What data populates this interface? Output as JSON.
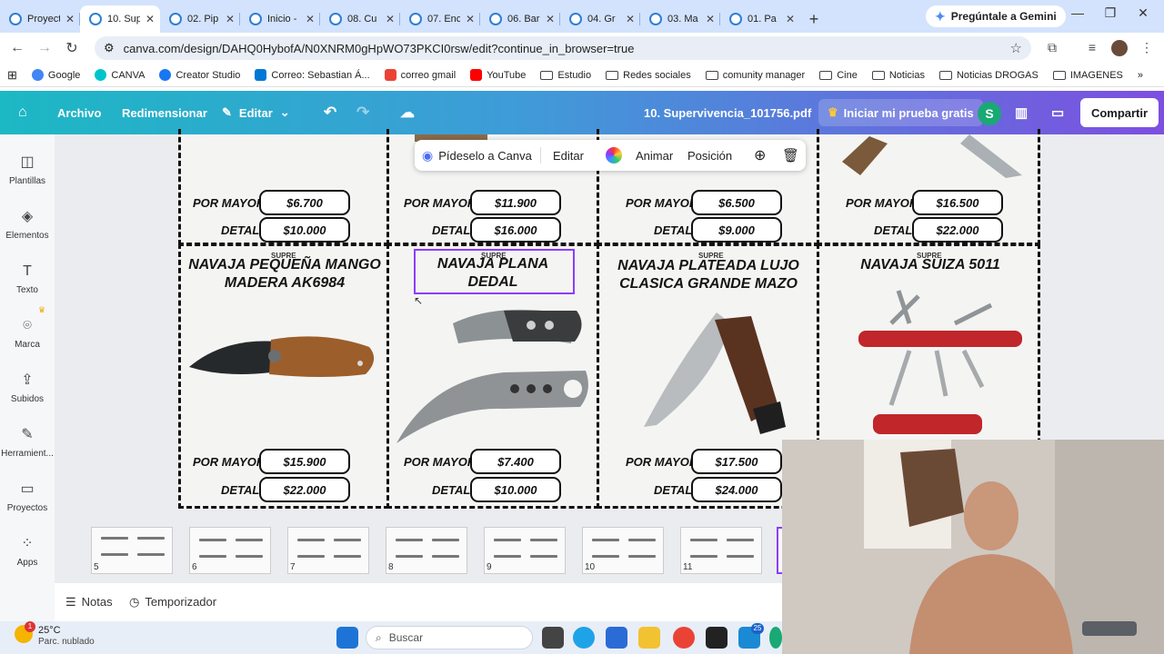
{
  "browser": {
    "tabs": [
      {
        "label": "Proyect",
        "active": false
      },
      {
        "label": "10. Sup",
        "active": true
      },
      {
        "label": "02. Pip",
        "active": false
      },
      {
        "label": "Inicio -",
        "active": false
      },
      {
        "label": "08. Cu",
        "active": false
      },
      {
        "label": "07. Enc",
        "active": false
      },
      {
        "label": "06. Bar",
        "active": false
      },
      {
        "label": "04. Gr",
        "active": false
      },
      {
        "label": "03. Ma",
        "active": false
      },
      {
        "label": "01. Pa",
        "active": false
      }
    ],
    "new_tab": "+",
    "gemini_label": "Pregúntale a Gemini",
    "url": "canva.com/design/DAHQ0HybofA/N0XNRM0gHpWO73PKCI0rsw/edit?continue_in_browser=true",
    "bookmarks": [
      {
        "label": "Google",
        "type": "site",
        "color": "#4285f4"
      },
      {
        "label": "CANVA",
        "type": "site",
        "color": "#00c4cc"
      },
      {
        "label": "Creator Studio",
        "type": "site",
        "color": "#1877f2"
      },
      {
        "label": "Correo: Sebastian Á...",
        "type": "site",
        "color": "#0078d4"
      },
      {
        "label": "correo gmail",
        "type": "site",
        "color": "#ea4335"
      },
      {
        "label": "YouTube",
        "type": "site",
        "color": "#ff0000"
      },
      {
        "label": "Estudio",
        "type": "folder"
      },
      {
        "label": "Redes sociales",
        "type": "folder"
      },
      {
        "label": "comunity manager",
        "type": "folder"
      },
      {
        "label": "Cine",
        "type": "folder"
      },
      {
        "label": "Noticias",
        "type": "folder"
      },
      {
        "label": "Noticias DROGAS",
        "type": "folder"
      },
      {
        "label": "IMAGENES",
        "type": "folder"
      }
    ]
  },
  "canva": {
    "menu": {
      "archivo": "Archivo",
      "redimensionar": "Redimensionar",
      "editar": "Editar"
    },
    "doc_title": "10. Supervivencia_101756.pdf",
    "trial_label": "Iniciar mi prueba gratis",
    "avatar_letter": "S",
    "share_label": "Compartir",
    "sidebar": [
      {
        "label": "Plantillas",
        "icon": "layout-icon"
      },
      {
        "label": "Elementos",
        "icon": "shapes-icon"
      },
      {
        "label": "Texto",
        "icon": "text-icon"
      },
      {
        "label": "Marca",
        "icon": "brand-icon"
      },
      {
        "label": "Subidos",
        "icon": "upload-icon"
      },
      {
        "label": "Herramient...",
        "icon": "tools-icon"
      },
      {
        "label": "Proyectos",
        "icon": "folder-icon"
      },
      {
        "label": "Apps",
        "icon": "apps-icon"
      }
    ],
    "floating_toolbar": {
      "ask": "Pídeselo a Canva",
      "edit": "Editar",
      "animate": "Animar",
      "position": "Posición"
    },
    "price_labels": {
      "wholesale": "POR MAYOR",
      "retail": "DETAL"
    },
    "top_row": [
      {
        "wholesale": "$6.700",
        "retail": "$10.000"
      },
      {
        "wholesale": "$11.900",
        "retail": "$16.000"
      },
      {
        "wholesale": "$6.500",
        "retail": "$9.000"
      },
      {
        "wholesale": "$16.500",
        "retail": "$22.000"
      }
    ],
    "bottom_row": [
      {
        "title": "NAVAJA PEQUEÑA MANGO MADERA AK6984",
        "ghost": "SUPRE",
        "wholesale": "$15.900",
        "retail": "$22.000"
      },
      {
        "title": "NAVAJA PLANA DEDAL",
        "ghost": "SUPRE",
        "wholesale": "$7.400",
        "retail": "$10.000"
      },
      {
        "title": "NAVAJA PLATEADA LUJO CLASICA GRANDE MAZO",
        "ghost": "SUPRE",
        "wholesale": "$17.500",
        "retail": "$24.000"
      },
      {
        "title": "NAVAJA SUIZA 5011",
        "ghost": "SUPRE",
        "wholesale": "",
        "retail": ""
      }
    ],
    "thumbnails": [
      "5",
      "6",
      "7",
      "8",
      "9",
      "10",
      "11"
    ],
    "bottom_bar": {
      "notes": "Notas",
      "timer": "Temporizador"
    }
  },
  "taskbar": {
    "temperature": "25°C",
    "weather": "Parc. nublado",
    "search_placeholder": "Buscar",
    "weather_badge": "1",
    "notification_badge": "25"
  }
}
